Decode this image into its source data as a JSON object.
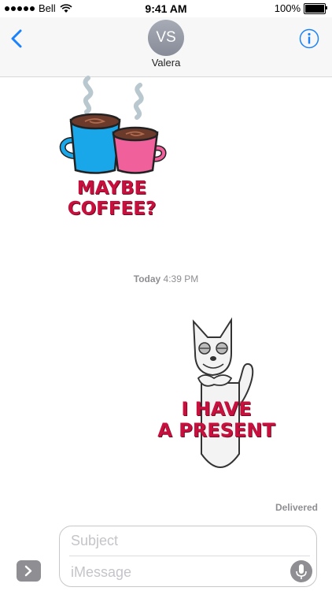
{
  "status_bar": {
    "carrier": "Bell",
    "time": "9:41 AM",
    "battery": "100%",
    "battery_level": 1.0
  },
  "header": {
    "avatar_initials": "VS",
    "contact_name": "Valera",
    "back_icon": "chevron-left-icon",
    "info_icon": "info-icon"
  },
  "messages": [
    {
      "type": "sticker",
      "caption_line1": "MAYBE",
      "caption_line2": "COFFEE?"
    },
    {
      "type": "timestamp",
      "day": "Today",
      "time": "4:39 PM"
    },
    {
      "type": "sticker",
      "caption_line1": "I HAVE",
      "caption_line2": "A PRESENT"
    }
  ],
  "delivery_status": "Delivered",
  "composer": {
    "subject_placeholder": "Subject",
    "message_placeholder": "iMessage"
  },
  "colors": {
    "accent": "#1a82fb",
    "sticker_text": "#c8103e",
    "cup_blue": "#1aa7ea",
    "cup_pink": "#f0609b"
  }
}
